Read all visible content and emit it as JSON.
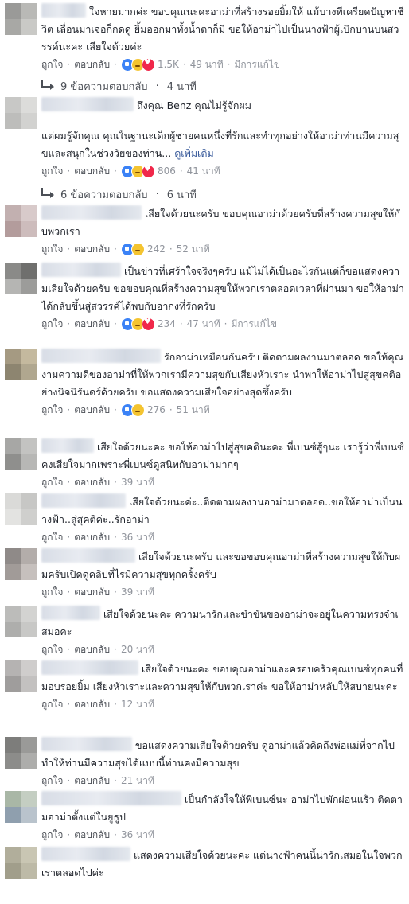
{
  "comments": [
    {
      "text": "ใจหายมากค่ะ ขอบคุณนะคะอาม่าที่สร้างรอยยิ้มให้ แม้บางทีเครียดปัญหาชีวิต เลื่อนมาเจอก็กดดู ยิ้มออกมาทั้งน้ำตาก็มี ขอให้อาม่าไปเป็นนางฟ้าผู้เบิกบานบนสวรรค์นะคะ เสียใจด้วยค่ะ",
      "like": "ถูกใจ",
      "reply": "ตอบกลับ",
      "count": "1.5K",
      "time": "49 นาที",
      "edited": "มีการแก้ไข",
      "reactions": [
        "like-reaction-icon",
        "sad-reaction-icon",
        "love-reaction-icon"
      ],
      "replies_text": "9 ข้อความตอบกลับ",
      "replies_time": "4 นาที",
      "avatar": [
        "#9a9a98",
        "#b9b9b6",
        "#a8a8a5",
        "#c9c9c6"
      ]
    },
    {
      "text": "ถึงคุณ Benz คุณไม่รู้จักผม",
      "text2": "แต่ผมรู้จักคุณ คุณในฐานะเด็กผู้ชายคนหนึ่งที่รักและทำทุกอย่างให้อาม่าท่านมีความสุขและสนุกในช่วงวัยของท่าน...",
      "see_more": "ดูเพิ่มเติม",
      "like": "ถูกใจ",
      "reply": "ตอบกลับ",
      "count": "806",
      "time": "41 นาที",
      "reactions": [
        "like-reaction-icon",
        "sad-reaction-icon",
        "love-reaction-icon"
      ],
      "replies_text": "6 ข้อความตอบกลับ",
      "replies_time": "6 นาที",
      "avatar": [
        "#c8c8c6",
        "#dcdcda",
        "#bdbdbb",
        "#d2d2d0"
      ]
    },
    {
      "text": "เสียใจด้วยนะครับ ขอบคุณอาม่าด้วยครับที่สร้างความสุขให้กับพวกเรา",
      "like": "ถูกใจ",
      "reply": "ตอบกลับ",
      "count": "242",
      "time": "52 นาที",
      "reactions": [
        "like-reaction-icon",
        "sad-reaction-icon"
      ],
      "avatar": [
        "#c2b0b0",
        "#d8caca",
        "#b39c9c",
        "#cdbcbc"
      ]
    },
    {
      "text": "เป็นข่าวที่เศร้าใจจริงๆครับ แม้ไม่ได้เป็นอะไรกันแต่ก็ขอแสดงความเสียใจด้วยครับ ขอขอบคุณที่สร้างความสุขให้พวกเราตลอดเวลาที่ผ่านมา ขอให้อาม่าได้กลับขึ้นสู่สวรรค์ได้พบกับอากงที่รักครับ",
      "like": "ถูกใจ",
      "reply": "ตอบกลับ",
      "count": "234",
      "time": "47 นาที",
      "edited": "มีการแก้ไข",
      "reactions": [
        "like-reaction-icon",
        "sad-reaction-icon",
        "love-reaction-icon"
      ],
      "avatar": [
        "#8a8a88",
        "#6f6f6d",
        "#b5b5b3",
        "#9c9c9a"
      ]
    },
    {
      "text": "รักอาม่าเหมือนกันครับ ติดตามผลงานมาตลอด ขอให้คุณงามความดีของอาม่าที่ให้พวกเรามีความสุขกับเสียงหัวเราะ นำพาให้อาม่าไปสู่สุขคติอย่างนิจนิรันดร์ด้วยครับ ขอแสดงความเสียใจอย่างสุดซึ้งครับ",
      "like": "ถูกใจ",
      "reply": "ตอบกลับ",
      "count": "276",
      "time": "51 นาที",
      "reactions": [
        "like-reaction-icon",
        "sad-reaction-icon"
      ],
      "avatar": [
        "#a59a82",
        "#c4b99e",
        "#8d8570",
        "#b0a78f"
      ]
    },
    {
      "text": "เสียใจด้วยนะคะ ขอให้อาม่าไปสู่สุขคตินะคะ พี่เบนซ์สู้ๆนะ เรารู้ว่าพี่เบนซ์คงเสียใจมากเพราะพี่เบนซ์ดูสนิทกับอาม่ามากๆ",
      "like": "ถูกใจ",
      "reply": "ตอบกลับ",
      "time": "39 นาที",
      "avatar": [
        "#a7a7a5",
        "#c3c3c1",
        "#8f8f8d",
        "#b7b7b5"
      ]
    },
    {
      "text": "เสียใจด้วยนะค่ะ..ติดตามผลงานอาม่ามาตลอด..ขอให้อาม่าเป็นนางฟ้า..สู่สุคติค่ะ..รักอาม่า",
      "like": "ถูกใจ",
      "reply": "ตอบกลับ",
      "time": "36 นาที",
      "avatar": [
        "#dadad8",
        "#c7c7c5",
        "#e3e3e1",
        "#cfcfcd"
      ]
    },
    {
      "text": "เสียใจด้วยนะครับ และขอขอบคุณอาม่าที่สร้างความสุขให้กับผมครับเปิดดูคลิปที่ไรมีความสุขทุกครั้งครับ",
      "like": "ถูกใจ",
      "reply": "ตอบกลับ",
      "time": "39 นาที",
      "avatar": [
        "#8f8a88",
        "#b3adaa",
        "#a19b98",
        "#c6c0bd"
      ]
    },
    {
      "text": "เสียใจด้วยนะคะ ความน่ารักและขำขันของอาม่าจะอยู่ในความทรงจำเสมอคะ",
      "like": "ถูกใจ",
      "reply": "ตอบกลับ",
      "time": "20 นาที",
      "avatar": [
        "#bcbcba",
        "#d3d3d1",
        "#aeaeac",
        "#c8c8c6"
      ]
    },
    {
      "text": "เสียใจด้วยนะคะ ขอบคุณอาม่าและครอบครัวคุณเบนซ์ทุกคนที่มอบรอยยิ้ม เสียงหัวเราะและความสุขให้กับพวกเราค่ะ ขอให้อาม่าหลับให้สบายนะคะ",
      "like": "ถูกใจ",
      "reply": "ตอบกลับ",
      "time": "12 นาที",
      "avatar": [
        "#b5b3b2",
        "#cfcdcc",
        "#9f9d9c",
        "#c3c1c0"
      ]
    },
    {
      "text": "ขอแสดงความเสียใจด้วยครับ ดูอาม่าแล้วคิดถึงพ่อแม่ที่จากไป ทำให้ท่านมีความสุขได้แบบนี้ท่านคงมีความสุข",
      "like": "ถูกใจ",
      "reply": "ตอบกลับ",
      "time": "21 นาที",
      "avatar": [
        "#7d7d7b",
        "#9a9a98",
        "#8c8c8a",
        "#adadab"
      ]
    },
    {
      "text": "เป็นกำลังใจให้พี่เบนซ์นะ อาม่าไปพักผ่อนแร้ว ติดตามอาม่าตั้งแต่ในยูธูป",
      "like": "ถูกใจ",
      "reply": "ตอบกลับ",
      "time": "36 นาที",
      "avatar": [
        "#a9b7a6",
        "#c4cec2",
        "#8f9fae",
        "#b9c3cc"
      ]
    },
    {
      "text": "แสดงความเสียใจด้วยนะคะ แต่นางฟ้าคนนี้น่ารักเสมอในใจพวกเราตลอดไปค่ะ",
      "avatar": [
        "#b1ae9b",
        "#c9c6b3",
        "#a19e8b",
        "#bdbaa7"
      ]
    }
  ]
}
